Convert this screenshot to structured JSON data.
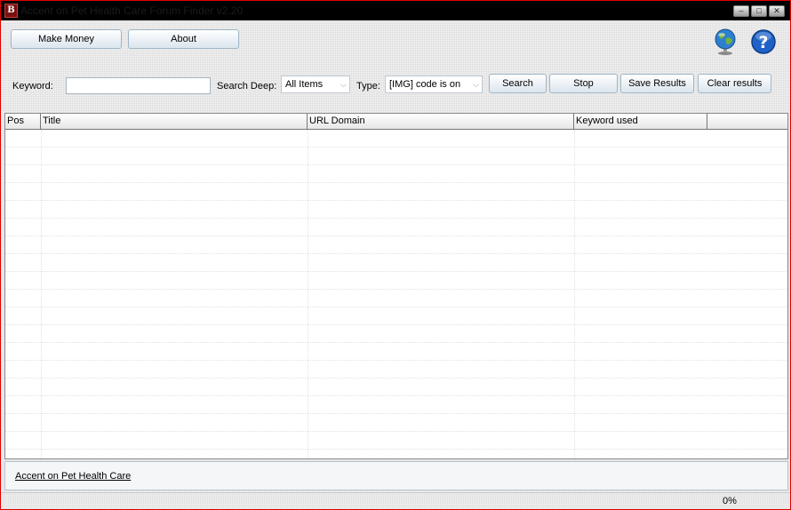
{
  "window": {
    "title": "Accent on Pet Health Care Forum Finder v2.20"
  },
  "toolbar": {
    "make_money": "Make Money",
    "about": "About"
  },
  "search": {
    "keyword_label": "Keyword:",
    "keyword_value": "",
    "deep_label": "Search Deep:",
    "deep_value": "All Items",
    "type_label": "Type:",
    "type_value": "[IMG] code is on",
    "search_btn": "Search",
    "stop_btn": "Stop",
    "save_btn": "Save Results",
    "clear_btn": "Clear results"
  },
  "table": {
    "columns": [
      "Pos",
      "Title",
      "URL Domain",
      "Keyword used",
      ""
    ]
  },
  "footer": {
    "link": "Accent on Pet Health Care"
  },
  "status": {
    "progress": "0%"
  },
  "icons": {
    "globe": "globe-icon",
    "help": "help-icon"
  }
}
